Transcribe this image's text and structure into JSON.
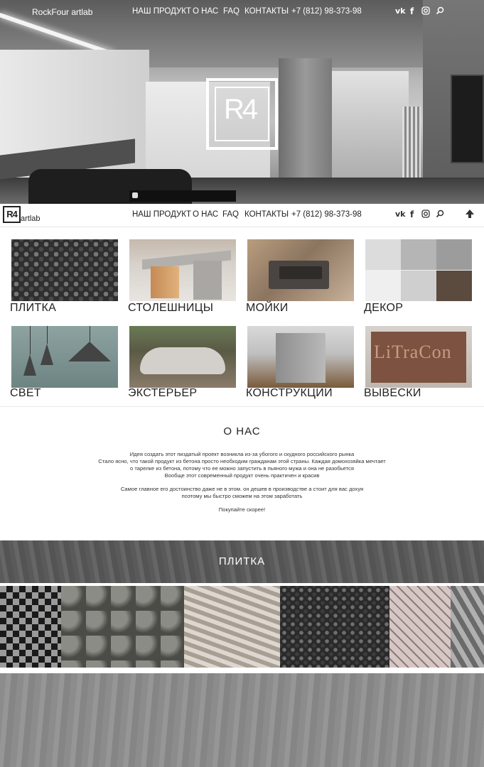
{
  "hero": {
    "brand": "RockFour artlab",
    "logo_text": "R4"
  },
  "nav": {
    "items": [
      {
        "label": "НАШ ПРОДУКТ"
      },
      {
        "label": "О НАС"
      },
      {
        "label": "FAQ"
      },
      {
        "label": "КОНТАКТЫ"
      }
    ],
    "phone": "+7 (812) 98-373-98"
  },
  "sticky": {
    "logo_text": "R4",
    "logo_suffix": "artlab"
  },
  "social": {
    "vk": "vk-icon",
    "facebook": "facebook-icon",
    "instagram": "instagram-icon",
    "search": "search-icon",
    "up": "arrow-up-icon"
  },
  "categories": [
    {
      "label": "ПЛИТКА"
    },
    {
      "label": "СТОЛЕШНИЦЫ"
    },
    {
      "label": "МОЙКИ"
    },
    {
      "label": "ДЕКОР"
    },
    {
      "label": "СВЕТ"
    },
    {
      "label": "ЭКСТЕРЬЕР"
    },
    {
      "label": "КОНСТРУКЦИИ"
    },
    {
      "label": "ВЫВЕСКИ"
    }
  ],
  "sign_image_text": "LiTraCon",
  "about": {
    "title": "О НАС",
    "lines": [
      "Идея создать этот пиздатый проект возникла из-за убогого и скудного российского рынка",
      "Стало ясно, что такой продукт из бетона просто необходим гражданам этой страны. Каждая домохозяйка мечтает",
      "о тарелке из бетона, потому что ее можно запустить в пьяного мужа и она не разобьется",
      "Вообще этот современный продукт очень практичен и красив",
      "Самое главное его достоинство даже не в этом. он дешев в производстве а стоит для вас дохуя",
      "поэтому мы быстро сможем на этом заработать",
      "Покупайте скорее!"
    ]
  },
  "tiles_section": {
    "title": "ПЛИТКА"
  }
}
